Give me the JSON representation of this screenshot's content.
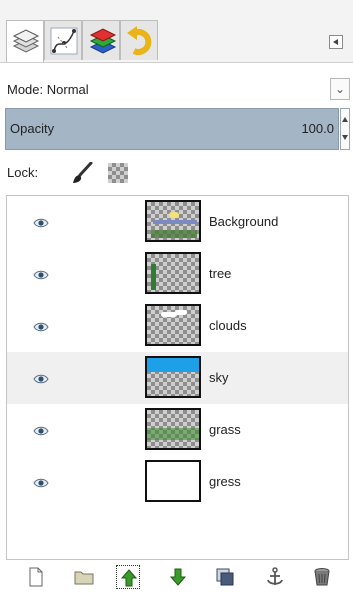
{
  "tabs": [
    {
      "icon": "layers-icon",
      "active": true
    },
    {
      "icon": "paths-icon",
      "active": false
    },
    {
      "icon": "channels-icon",
      "active": false
    },
    {
      "icon": "undo-history-icon",
      "active": false
    }
  ],
  "mode": {
    "label": "Mode: Normal"
  },
  "opacity": {
    "label": "Opacity",
    "value": "100.0"
  },
  "lock": {
    "label": "Lock:"
  },
  "layers": [
    {
      "name": "Background",
      "visible": true,
      "selected": false,
      "thumb": "background"
    },
    {
      "name": "tree",
      "visible": true,
      "selected": false,
      "thumb": "tree"
    },
    {
      "name": "clouds",
      "visible": true,
      "selected": false,
      "thumb": "clouds"
    },
    {
      "name": "sky",
      "visible": true,
      "selected": true,
      "thumb": "sky"
    },
    {
      "name": "grass",
      "visible": true,
      "selected": false,
      "thumb": "grass"
    },
    {
      "name": "gress",
      "visible": true,
      "selected": false,
      "thumb": "white"
    }
  ],
  "toolbar": [
    "new-layer-icon",
    "new-layer-group-icon",
    "raise-layer-icon",
    "lower-layer-icon",
    "duplicate-layer-icon",
    "anchor-layer-icon",
    "delete-layer-icon"
  ],
  "colors": {
    "selection": "#a4b6c6",
    "selected_row": "#f0f0f0",
    "arrow_green": "#3a9a2a"
  }
}
